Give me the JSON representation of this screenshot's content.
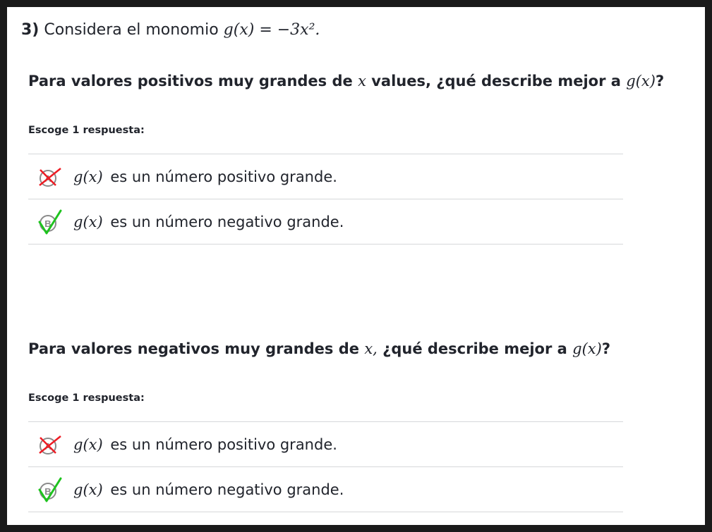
{
  "header": {
    "number": "3)",
    "text": "Considera el monomio",
    "formula": "g(x) = −3x²."
  },
  "questions": [
    {
      "text_before": "Para valores positivos muy grandes de",
      "var": "x",
      "text_middle": "values, ¿qué describe mejor a",
      "func": "g(x)",
      "text_after": "?",
      "prompt": "Escoge 1 respuesta:",
      "choices": [
        {
          "letter": "A",
          "math": "g(x)",
          "text": "es un número positivo grande.",
          "mark": "incorrect"
        },
        {
          "letter": "B",
          "math": "g(x)",
          "text": "es un número negativo grande.",
          "mark": "correct"
        }
      ]
    },
    {
      "text_before": "Para valores negativos muy grandes de",
      "var": "x,",
      "text_middle": "¿qué describe mejor a",
      "func": "g(x)",
      "text_after": "?",
      "prompt": "Escoge 1 respuesta:",
      "choices": [
        {
          "letter": "A",
          "math": "g(x)",
          "text": "es un número positivo grande.",
          "mark": "incorrect"
        },
        {
          "letter": "B",
          "math": "g(x)",
          "text": "es un número negativo grande.",
          "mark": "correct"
        }
      ]
    }
  ],
  "colors": {
    "incorrect_mark": "#ee1c24",
    "correct_mark": "#1ec31e",
    "circle": "#8a8a8a"
  }
}
